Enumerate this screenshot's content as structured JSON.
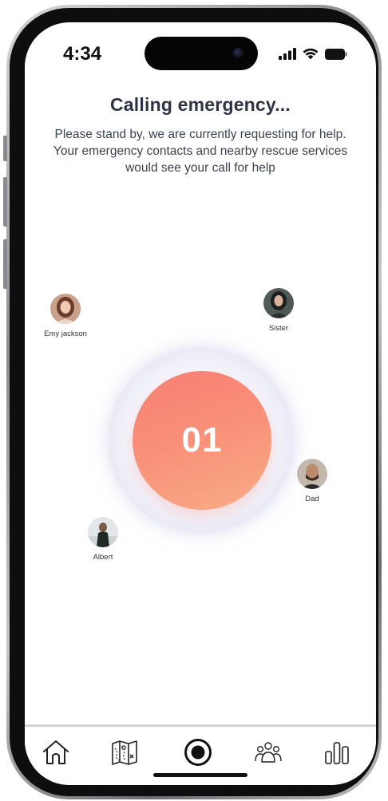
{
  "status_bar": {
    "time": "4:34",
    "icons": [
      "signal-icon",
      "wifi-icon",
      "battery-icon"
    ]
  },
  "header": {
    "title": "Calling emergency...",
    "subtitle": "Please stand by, we are currently requesting for help. Your emergency contacts and nearby rescue services would see your call for help"
  },
  "counter": {
    "value": "01",
    "gradient_start": "#f77f72",
    "gradient_end": "#f9ac86"
  },
  "contacts": [
    {
      "name": "Emy jackson"
    },
    {
      "name": "Sister"
    },
    {
      "name": "Dad"
    },
    {
      "name": "Albert"
    }
  ],
  "bottom_nav": {
    "items": [
      {
        "icon": "home-icon"
      },
      {
        "icon": "map-icon"
      },
      {
        "icon": "record-icon"
      },
      {
        "icon": "people-icon"
      },
      {
        "icon": "bar-chart-icon"
      }
    ]
  },
  "colors": {
    "title": "#2e3445",
    "text": "#3d4250",
    "accent": "#f77f72"
  }
}
